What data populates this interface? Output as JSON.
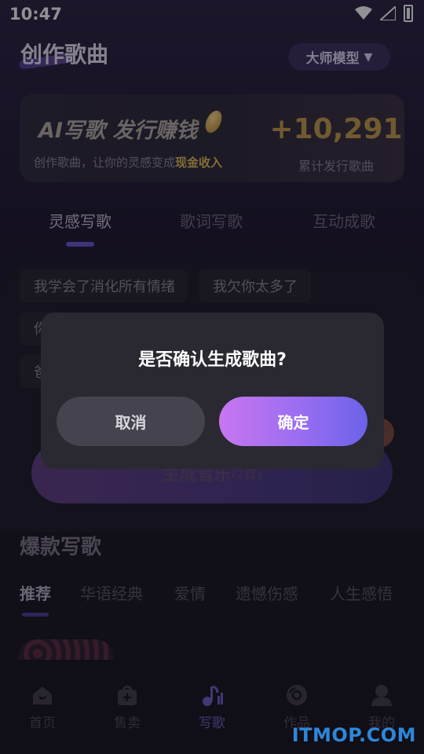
{
  "status_bar": {
    "time": "10:47"
  },
  "header": {
    "title": "创作歌曲",
    "model_button": "大师模型",
    "model_caret": "▼"
  },
  "banner": {
    "title": "AI写歌 发行赚钱",
    "subtitle_prefix": "创作歌曲，让你的灵感变成",
    "subtitle_highlight": "现金收入",
    "count": "+10,291",
    "count_label": "累计发行歌曲"
  },
  "mode_tabs": [
    {
      "label": "灵感写歌",
      "active": true
    },
    {
      "label": "歌词写歌",
      "active": false
    },
    {
      "label": "互动成歌",
      "active": false
    }
  ],
  "prompt_chips": [
    {
      "label": "我学会了消化所有情绪"
    },
    {
      "label": "我欠你太多了"
    },
    {
      "label": "你"
    },
    {
      "label": "爸"
    }
  ],
  "generate_button": {
    "label": "生成音乐",
    "count": "(2首)"
  },
  "hot_section": {
    "title": "爆款写歌",
    "categories": [
      {
        "label": "推荐",
        "active": true
      },
      {
        "label": "华语经典",
        "active": false
      },
      {
        "label": "爱情",
        "active": false
      },
      {
        "label": "遗憾伤感",
        "active": false
      },
      {
        "label": "人生感悟",
        "active": false
      }
    ]
  },
  "bottom_nav": [
    {
      "label": "首页",
      "icon": "home-icon",
      "active": false
    },
    {
      "label": "售卖",
      "icon": "bag-icon",
      "active": false
    },
    {
      "label": "写歌",
      "icon": "music-note-icon",
      "active": true
    },
    {
      "label": "作品",
      "icon": "disc-icon",
      "active": false
    },
    {
      "label": "我的",
      "icon": "user-icon",
      "active": false
    }
  ],
  "dialog": {
    "title": "是否确认生成歌曲?",
    "cancel_label": "取消",
    "confirm_label": "确定"
  },
  "watermark": "ITMOP.COM",
  "colors": {
    "accent_purple": "#6b56d4",
    "confirm_gradient_start": "#c876f0",
    "confirm_gradient_end": "#6b63e9",
    "banner_gold": "#c49d4a"
  }
}
